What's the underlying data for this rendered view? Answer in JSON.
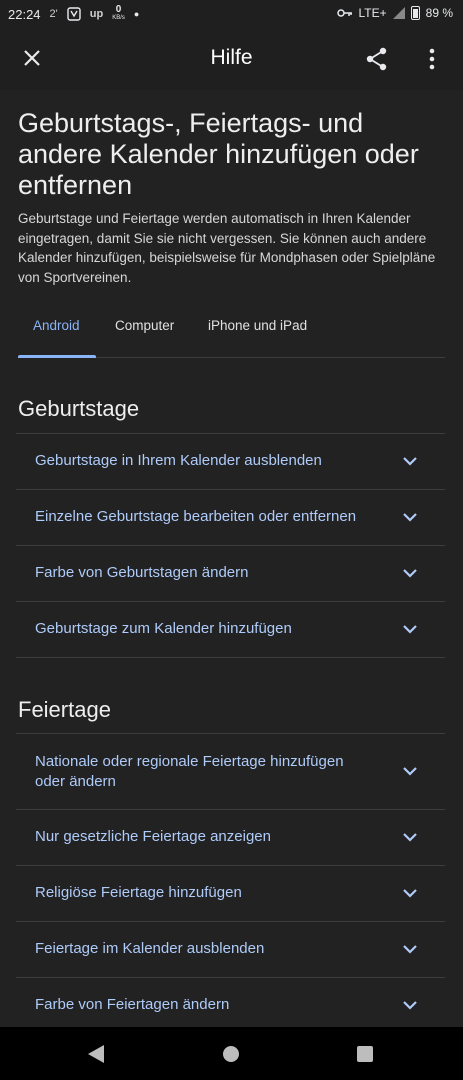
{
  "status_bar": {
    "time": "22:24",
    "notif_count": "2'",
    "up_label": "up",
    "net_speed_value": "0",
    "net_speed_unit": "KB/s",
    "network": "LTE+",
    "battery": "89 %"
  },
  "appbar": {
    "title": "Hilfe",
    "close_icon": "close-icon",
    "share_icon": "share-icon",
    "more_icon": "more-vert-icon"
  },
  "article": {
    "title": "Geburtstags-, Feiertags- und andere Kalender hinzufügen oder entfernen",
    "intro": "Geburtstage und Feiertage werden automatisch in Ihren Kalender eingetragen, damit Sie sie nicht vergessen. Sie können auch andere Kalender hinzufügen, beispielsweise für Mondphasen oder Spielpläne von Sportvereinen."
  },
  "tabs": [
    {
      "label": "Android",
      "active": true
    },
    {
      "label": "Computer",
      "active": false
    },
    {
      "label": "iPhone und iPad",
      "active": false
    }
  ],
  "sections": [
    {
      "title": "Geburtstage",
      "items": [
        "Geburtstage in Ihrem Kalender ausblenden",
        "Einzelne Geburtstage bearbeiten oder entfernen",
        "Farbe von Geburtstagen ändern",
        "Geburtstage zum Kalender hinzufügen"
      ]
    },
    {
      "title": "Feiertage",
      "items": [
        "Nationale oder regionale Feiertage hinzufügen oder ändern",
        "Nur gesetzliche Feiertage anzeigen",
        "Religiöse Feiertage hinzufügen",
        "Feiertage im Kalender ausblenden",
        "Farbe von Feiertagen ändern"
      ]
    }
  ],
  "colors": {
    "accent": "#8ab4f8",
    "link": "#aecbfa",
    "background": "#222222",
    "divider": "#3c3c3c"
  },
  "navbar": {
    "back_icon": "back-triangle-icon",
    "home_icon": "home-circle-icon",
    "recent_icon": "recents-square-icon"
  }
}
